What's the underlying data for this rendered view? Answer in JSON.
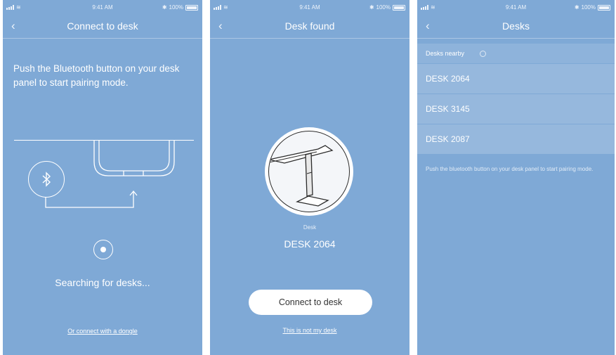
{
  "status": {
    "time": "9:41 AM",
    "battery": "100%"
  },
  "screen1": {
    "title": "Connect to desk",
    "back_icon": "‹",
    "instruction": "Push the Bluetooth button on your desk panel to start pairing mode.",
    "bluetooth_icon": "bluetooth-icon",
    "searching": "Searching for desks...",
    "dongle_link": "Or connect with a dongle"
  },
  "screen2": {
    "title": "Desk found",
    "back_icon": "‹",
    "desk_label": "Desk",
    "desk_name": "DESK 2064",
    "connect_button": "Connect to desk",
    "not_my_desk": "This is not my desk"
  },
  "screen3": {
    "title": "Desks",
    "back_icon": "‹",
    "nearby_label": "Desks nearby",
    "desks": [
      {
        "name": "DESK 2064"
      },
      {
        "name": "DESK 3145"
      },
      {
        "name": "DESK 2087"
      }
    ],
    "hint": "Push the bluetooth button on your desk panel to start pairing mode."
  },
  "colors": {
    "background": "#7fa9d6",
    "accent": "#ffffff"
  }
}
